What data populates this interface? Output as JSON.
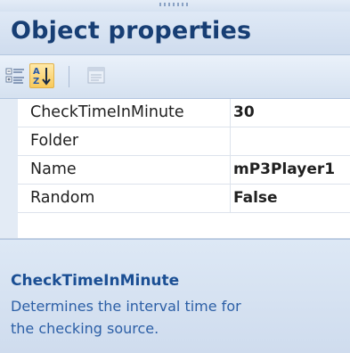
{
  "panel": {
    "title": "Object properties"
  },
  "toolbar": {
    "buttons": [
      {
        "name": "categorized",
        "icon": "categorized-view-icon",
        "state": "off"
      },
      {
        "name": "alphabetical",
        "icon": "sort-az-icon",
        "state": "on"
      },
      {
        "name": "property-pages",
        "icon": "property-pages-icon",
        "state": "disabled"
      }
    ]
  },
  "properties": [
    {
      "name": "CheckTimeInMinute",
      "value": "30"
    },
    {
      "name": "Folder",
      "value": ""
    },
    {
      "name": "Name",
      "value": "mP3Player1"
    },
    {
      "name": "Random",
      "value": "False"
    }
  ],
  "description": {
    "title": "CheckTimeInMinute",
    "text": "Determines the interval time for the checking source."
  },
  "colors": {
    "title_text": "#173e74",
    "description_title": "#1b4f94",
    "description_text": "#2c5fa6",
    "header_bg": "#cfdcee"
  }
}
